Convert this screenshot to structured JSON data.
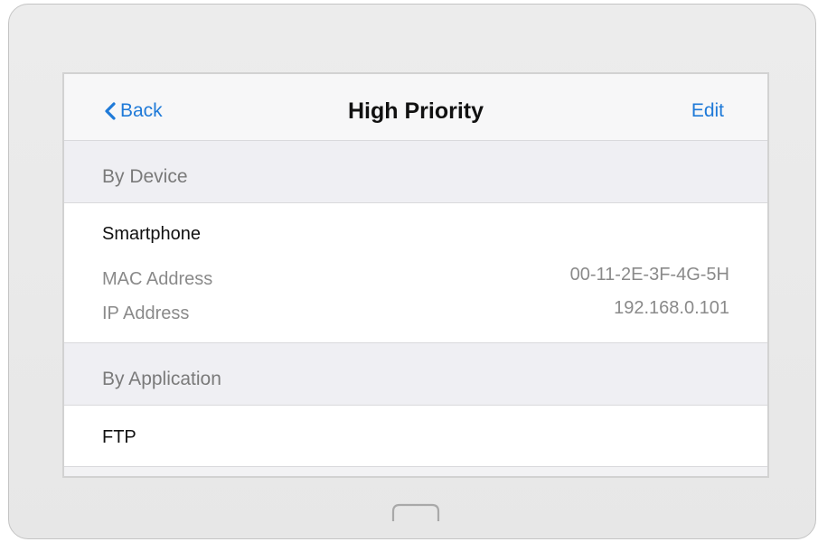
{
  "navbar": {
    "back_label": "Back",
    "title": "High Priority",
    "edit_label": "Edit"
  },
  "sections": {
    "by_device": {
      "header": "By Device",
      "device": {
        "name": "Smartphone",
        "mac_label": "MAC Address",
        "mac_value": "00-11-2E-3F-4G-5H",
        "ip_label": "IP Address",
        "ip_value": "192.168.0.101"
      }
    },
    "by_application": {
      "header": "By Application",
      "app": {
        "name": "FTP"
      }
    }
  },
  "colors": {
    "accent": "#1f7ad8"
  },
  "icons": {
    "back": "chevron-left-icon",
    "home": "home-button-icon"
  }
}
